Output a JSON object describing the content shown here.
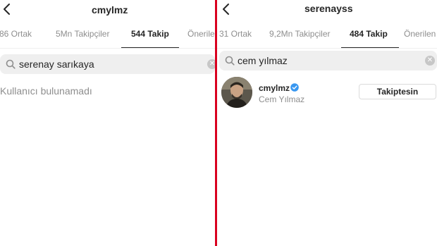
{
  "left": {
    "username": "cmylmz",
    "tabs": [
      {
        "label": "86 Ortak"
      },
      {
        "label": "5Mn Takipçiler"
      },
      {
        "label": "544 Takip"
      },
      {
        "label": "Önerilen"
      }
    ],
    "active_tab": "544 Takip",
    "search_value": "serenay sarıkaya",
    "empty_message": "Kullanıcı bulunamadı"
  },
  "right": {
    "username": "serenayss",
    "tabs": [
      {
        "label": "31 Ortak"
      },
      {
        "label": "9,2Mn Takipçiler"
      },
      {
        "label": "484 Takip"
      },
      {
        "label": "Önerilen"
      }
    ],
    "active_tab": "484 Takip",
    "search_value": "cem yılmaz",
    "result": {
      "username": "cmylmz",
      "full_name": "Cem Yılmaz",
      "verified": true,
      "follow_button_label": "Takiptesin"
    }
  },
  "icons": [
    "back-arrow-icon",
    "search-icon",
    "clear-icon",
    "verified-badge-icon"
  ],
  "colors": {
    "divider": "#d9001f",
    "verified": "#3897f0",
    "search_bg": "#efefef",
    "muted_text": "#8e8e8e"
  }
}
